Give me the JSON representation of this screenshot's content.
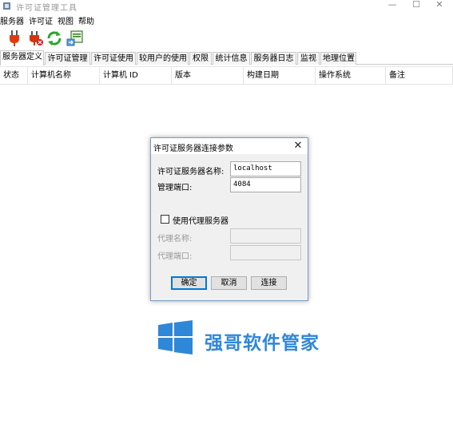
{
  "window": {
    "title": "许可证管理工具",
    "controls": {
      "minimize": "—",
      "maximize": "☐",
      "close": "✕"
    }
  },
  "menu": {
    "items": [
      "服务器",
      "许可证",
      "视图",
      "帮助"
    ]
  },
  "toolbar": {
    "buttons": [
      {
        "icon": "plug-connect-icon"
      },
      {
        "icon": "plug-disconnect-icon"
      },
      {
        "icon": "refresh-icon"
      },
      {
        "icon": "export-icon"
      }
    ]
  },
  "tabs": {
    "items": [
      "服务器定义",
      "许可证管理",
      "许可证使用",
      "较用户的使用",
      "权限",
      "统计信息",
      "服务器日志",
      "监视",
      "地理位置"
    ],
    "active_index": 0
  },
  "table": {
    "columns": [
      "状态",
      "计算机名称",
      "计算机 ID",
      "版本",
      "构建日期",
      "操作系统",
      "备注"
    ]
  },
  "dialog": {
    "title": "许可证服务器连接参数",
    "close": "✕",
    "server_name_label": "许可证服务器名称:",
    "server_name_value": "localhost",
    "port_label": "管理端口:",
    "port_value": "4084",
    "use_proxy_label": "使用代理服务器",
    "proxy_name_label": "代理名称:",
    "proxy_port_label": "代理端口:",
    "ok_label": "确定",
    "cancel_label": "取消",
    "connect_label": "连接"
  },
  "watermark": {
    "text": "强哥软件管家",
    "color": "#2f87d8"
  }
}
